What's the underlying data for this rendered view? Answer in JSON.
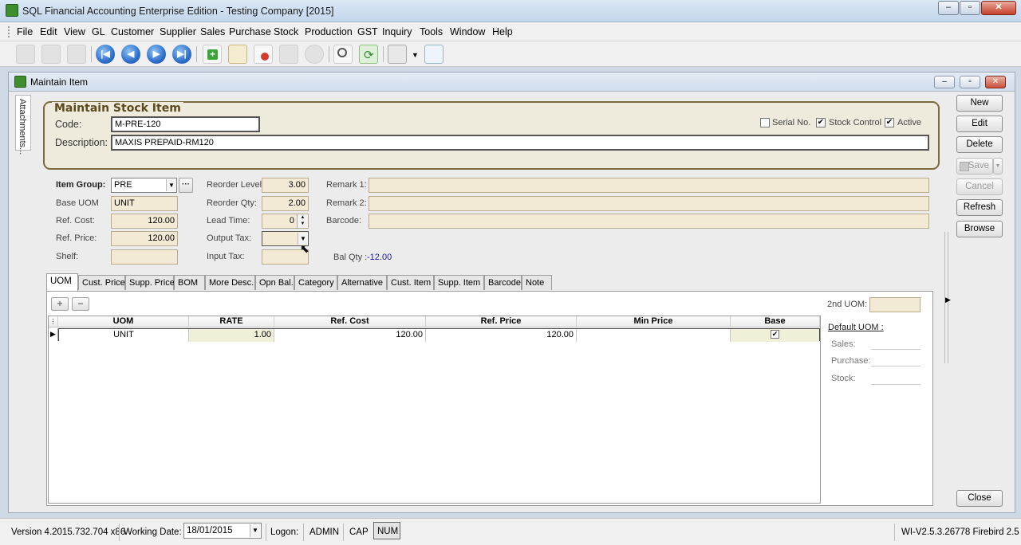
{
  "window": {
    "title": "SQL Financial Accounting Enterprise Edition - Testing Company [2015]"
  },
  "menu": [
    "File",
    "Edit",
    "View",
    "GL",
    "Customer",
    "Supplier",
    "Sales",
    "Purchase",
    "Stock",
    "Production",
    "GST",
    "Inquiry",
    "Tools",
    "Window",
    "Help"
  ],
  "toolbar_icons": [
    "cut-icon",
    "copy-icon",
    "paste-icon",
    "first-record-icon",
    "previous-record-icon",
    "next-record-icon",
    "last-record-icon",
    "new-icon",
    "edit-icon",
    "delete-icon",
    "save-icon",
    "cancel-icon",
    "find-icon",
    "refresh-icon",
    "print-icon",
    "preview-icon"
  ],
  "form": {
    "title": "Maintain Item",
    "attachments_tab": "Attachments...",
    "group_title": "Maintain Stock Item",
    "code_label": "Code:",
    "code_value": "M-PRE-120",
    "description_label": "Description:",
    "description_value": "MAXIS PREPAID-RM120",
    "serial_no_label": "Serial No.",
    "stock_control_label": "Stock Control",
    "active_label": "Active",
    "serial_no_checked": false,
    "stock_control_checked": true,
    "active_checked": true
  },
  "details": {
    "item_group_label": "Item Group:",
    "item_group_value": "PRE",
    "base_uom_label": "Base UOM",
    "base_uom_value": "UNIT",
    "ref_cost_label": "Ref. Cost:",
    "ref_cost_value": "120.00",
    "ref_price_label": "Ref. Price:",
    "ref_price_value": "120.00",
    "shelf_label": "Shelf:",
    "shelf_value": "",
    "reorder_level_label": "Reorder Level:",
    "reorder_level_value": "3.00",
    "reorder_qty_label": "Reorder Qty:",
    "reorder_qty_value": "2.00",
    "lead_time_label": "Lead Time:",
    "lead_time_value": "0",
    "output_tax_label": "Output Tax:",
    "output_tax_value": "",
    "input_tax_label": "Input Tax:",
    "input_tax_value": "",
    "bal_qty_label": "Bal Qty :",
    "bal_qty_value": "-12.00",
    "remark1_label": "Remark 1:",
    "remark2_label": "Remark 2:",
    "barcode_label": "Barcode:"
  },
  "tabs": [
    "UOM",
    "Cust. Price",
    "Supp. Price",
    "BOM",
    "More Desc.",
    "Opn Bal.",
    "Category",
    "Alternative",
    "Cust. Item",
    "Supp. Item",
    "Barcode",
    "Note"
  ],
  "active_tab": "UOM",
  "uom_grid": {
    "columns": [
      "UOM",
      "RATE",
      "Ref. Cost",
      "Ref. Price",
      "Min Price",
      "Base"
    ],
    "rows": [
      {
        "uom": "UNIT",
        "rate": "1.00",
        "ref_cost": "120.00",
        "ref_price": "120.00",
        "min_price": "",
        "base": true
      }
    ]
  },
  "uom_panel": {
    "second_uom_label": "2nd UOM:",
    "default_uom_label": "Default UOM :",
    "sales_label": "Sales:",
    "purchase_label": "Purchase:",
    "stock_label": "Stock:"
  },
  "buttons": {
    "new": "New",
    "edit": "Edit",
    "delete": "Delete",
    "save": "Save",
    "cancel": "Cancel",
    "refresh": "Refresh",
    "browse": "Browse",
    "close": "Close"
  },
  "status": {
    "version": "Version 4.2015.732.704 x86",
    "working_date_label": "Working Date:",
    "working_date": "18/01/2015",
    "logon_label": "Logon:",
    "user": "ADMIN",
    "cap": "CAP",
    "num": "NUM",
    "build": "WI-V2.5.3.26778 Firebird 2.5"
  },
  "colors": {
    "group_border": "#7a6a3e",
    "bal_qty": "#1a1aa8",
    "field_beige": "#f3ead6"
  }
}
